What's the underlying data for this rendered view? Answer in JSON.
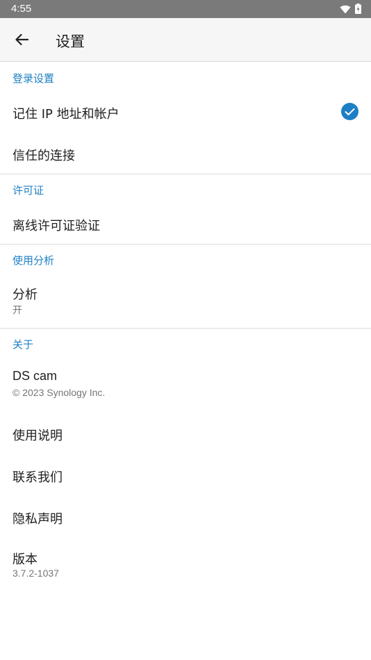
{
  "status": {
    "time": "4:55",
    "wifi_icon": "wifi-icon",
    "battery_icon": "battery-charging-icon"
  },
  "appbar": {
    "title": "设置",
    "back_icon": "arrow-left-icon"
  },
  "sections": {
    "login": {
      "header": "登录设置",
      "remember_ip": "记住 IP 地址和帐户",
      "remember_ip_checked": true,
      "trusted": "信任的连接"
    },
    "license": {
      "header": "许可证",
      "offline": "离线许可证验证"
    },
    "analytics": {
      "header": "使用分析",
      "label": "分析",
      "value": "开"
    },
    "about": {
      "header": "关于",
      "app_name": "DS cam",
      "copyright": "© 2023 Synology Inc.",
      "manual": "使用说明",
      "contact": "联系我们",
      "privacy": "隐私声明",
      "version_label": "版本",
      "version_value": "3.7.2-1037"
    }
  },
  "colors": {
    "accent": "#1d7fc4",
    "status_bar": "#7a7a7a",
    "app_bar": "#f6f6f6"
  }
}
